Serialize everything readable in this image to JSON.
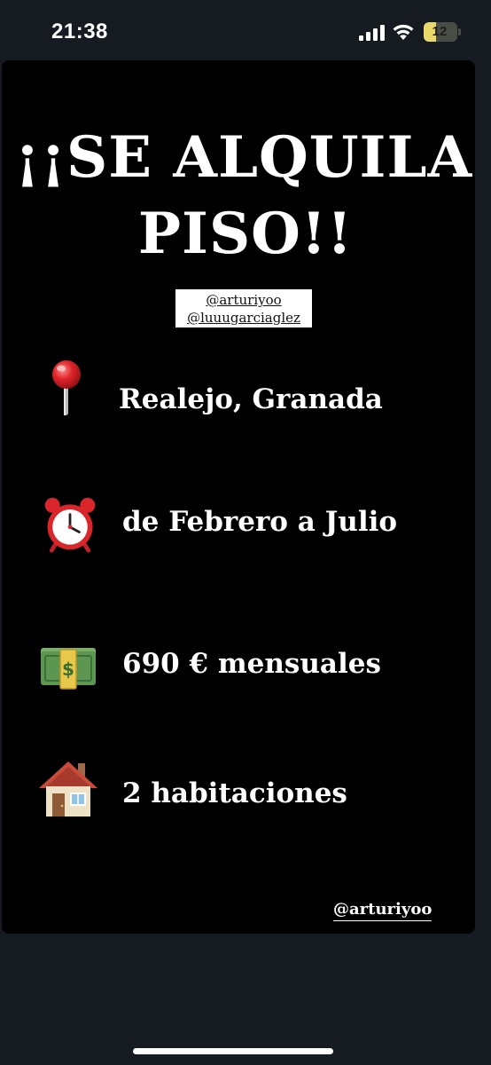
{
  "status_bar": {
    "time": "21:38",
    "battery_level": "12",
    "icons": [
      "cellular-signal-icon",
      "wifi-icon",
      "battery-icon"
    ],
    "battery_color": "#e9d86a"
  },
  "story": {
    "headline_line1": "¡¡SE ALQUILA",
    "headline_line2": "PISO!!",
    "mention_tags": [
      "@arturiyoo",
      "@luuugarciaglez"
    ],
    "items": [
      {
        "icon": "round-pushpin-icon",
        "text": "Realejo, Granada"
      },
      {
        "icon": "alarm-clock-icon",
        "text": "de Febrero a Julio"
      },
      {
        "icon": "money-banknotes-icon",
        "text": "690 € mensuales"
      },
      {
        "icon": "house-icon",
        "text": "2 habitaciones"
      }
    ],
    "watermark": "@arturiyoo",
    "background_color": "#000000"
  }
}
